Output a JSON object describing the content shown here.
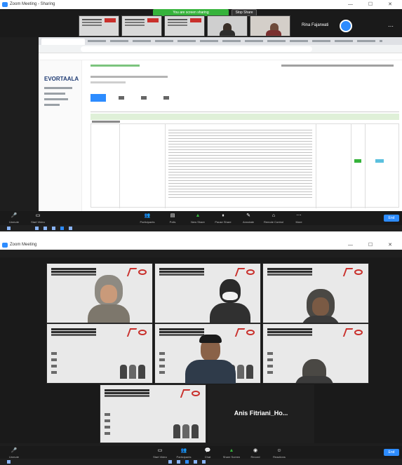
{
  "screenshot1": {
    "window_title": "Zoom Meeting - Sharing",
    "share_banner": "You are screen sharing",
    "stop_share_label": "Stop Share",
    "participant_name": "Rina Fajarwati",
    "app_logo": "EVORTAALA",
    "toolbar": {
      "items": [
        {
          "icon": "unmute-icon",
          "label": "Unmute"
        },
        {
          "icon": "video-icon",
          "label": "Start Video"
        },
        {
          "icon": "participants-icon",
          "label": "Participants"
        },
        {
          "icon": "polls-icon",
          "label": "Polls"
        },
        {
          "icon": "new-share-icon",
          "label": "New Share"
        },
        {
          "icon": "pause-share-icon",
          "label": "Pause Share"
        },
        {
          "icon": "annotate-icon",
          "label": "Annotate"
        },
        {
          "icon": "remote-control-icon",
          "label": "Remote Control"
        },
        {
          "icon": "more-icon",
          "label": "More"
        }
      ],
      "end_label": "End"
    }
  },
  "screenshot2": {
    "window_title": "Zoom Meeting",
    "name_tile": "Anis Fitriani_Ho...",
    "toolbar": {
      "items": [
        {
          "icon": "unmute-icon",
          "label": "Unmute"
        },
        {
          "icon": "video-icon",
          "label": "Start Video"
        },
        {
          "icon": "participants-icon",
          "label": "Participants"
        },
        {
          "icon": "chat-icon",
          "label": "Chat"
        },
        {
          "icon": "share-screen-icon",
          "label": "Share Screen"
        },
        {
          "icon": "record-icon",
          "label": "Record"
        },
        {
          "icon": "reactions-icon",
          "label": "Reactions"
        }
      ],
      "end_label": "End"
    }
  },
  "colors": {
    "zoom_blue": "#2d8cff",
    "share_green": "#36b33b",
    "dark_bg": "#1a1a1a",
    "slide_red": "#c9302c"
  }
}
